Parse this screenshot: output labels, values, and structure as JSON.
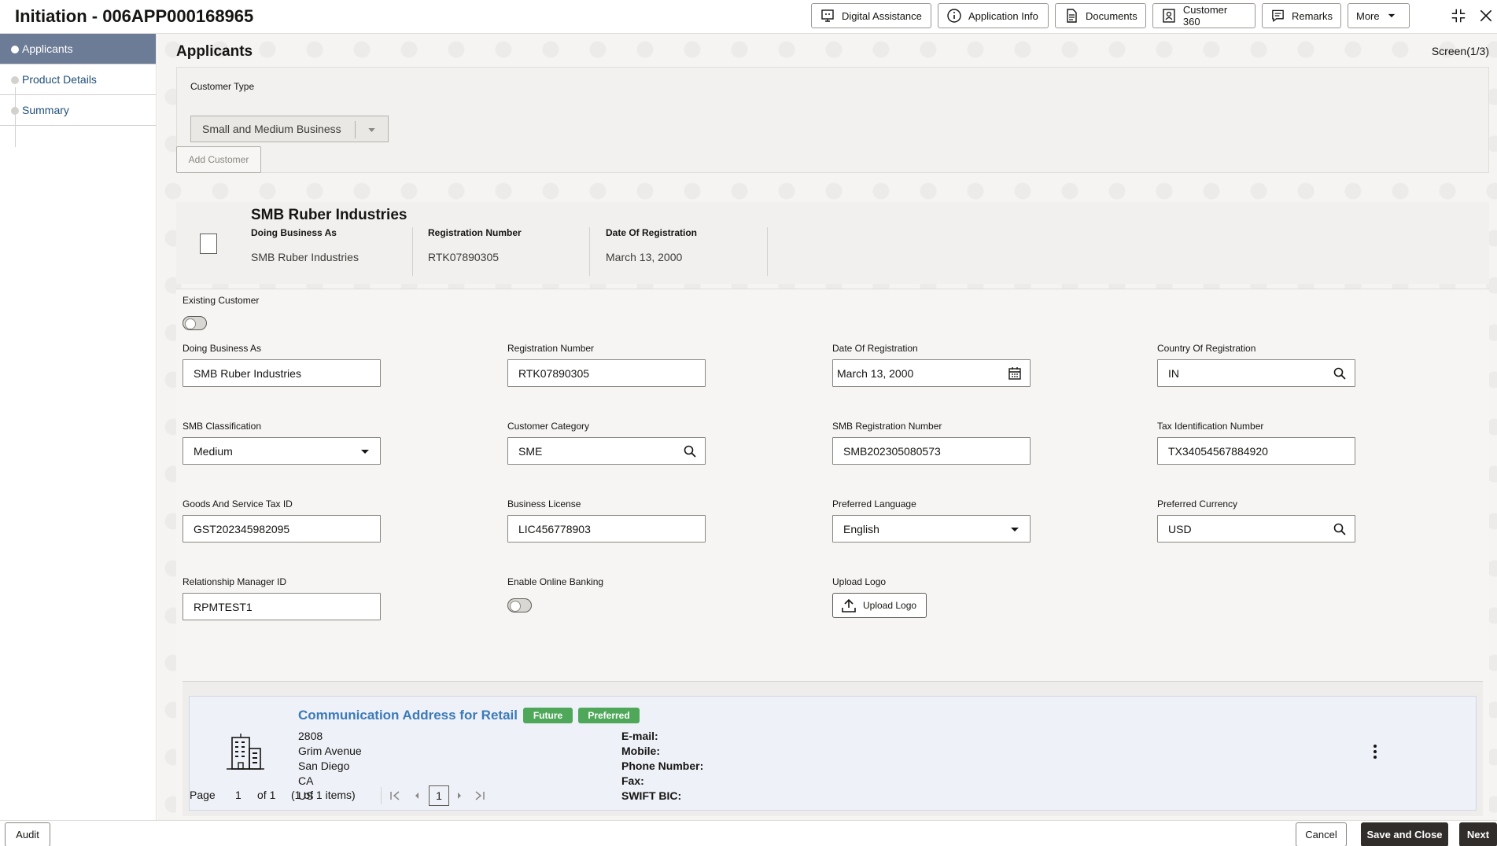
{
  "header": {
    "title": "Initiation - 006APP000168965",
    "buttons": {
      "digital_assistance": "Digital Assistance",
      "application_info": "Application Info",
      "documents": "Documents",
      "customer_360": "Customer 360",
      "remarks": "Remarks",
      "more": "More"
    }
  },
  "sidebar": {
    "items": [
      {
        "label": "Applicants",
        "active": true
      },
      {
        "label": "Product Details",
        "active": false
      },
      {
        "label": "Summary",
        "active": false
      }
    ]
  },
  "main": {
    "title": "Applicants",
    "screen_indicator": "Screen(1/3)",
    "customer_type": {
      "label": "Customer Type",
      "value": "Small and Medium Business"
    },
    "add_customer_label": "Add Customer",
    "customer_card": {
      "name": "SMB Ruber Industries",
      "doing_business_as_label": "Doing Business As",
      "doing_business_as": "SMB Ruber Industries",
      "registration_number_label": "Registration Number",
      "registration_number": "RTK07890305",
      "date_of_registration_label": "Date Of Registration",
      "date_of_registration": "March 13, 2000"
    },
    "form": {
      "existing_customer_label": "Existing Customer",
      "existing_customer": false,
      "doing_business_as": {
        "label": "Doing Business As",
        "value": "SMB Ruber Industries"
      },
      "registration_number": {
        "label": "Registration Number",
        "value": "RTK07890305"
      },
      "date_of_registration": {
        "label": "Date Of Registration",
        "value": "March 13, 2000"
      },
      "country_of_registration": {
        "label": "Country Of Registration",
        "value": "IN"
      },
      "smb_classification": {
        "label": "SMB Classification",
        "value": "Medium"
      },
      "customer_category": {
        "label": "Customer Category",
        "value": "SME"
      },
      "smb_registration_number": {
        "label": "SMB Registration Number",
        "value": "SMB202305080573"
      },
      "tax_identification_number": {
        "label": "Tax Identification Number",
        "value": "TX34054567884920"
      },
      "gst_id": {
        "label": "Goods And Service Tax ID",
        "value": "GST202345982095"
      },
      "business_license": {
        "label": "Business License",
        "value": "LIC456778903"
      },
      "preferred_language": {
        "label": "Preferred Language",
        "value": "English"
      },
      "preferred_currency": {
        "label": "Preferred Currency",
        "value": "USD"
      },
      "relationship_manager_id": {
        "label": "Relationship Manager ID",
        "value": "RPMTEST1"
      },
      "enable_online_banking_label": "Enable Online Banking",
      "enable_online_banking": false,
      "upload_logo_label": "Upload Logo",
      "upload_logo_button": "Upload Logo"
    },
    "address": {
      "title": "Communication Address for Retail",
      "badges": [
        "Future",
        "Preferred"
      ],
      "badge_color": "#4fa85a",
      "lines": [
        "2808",
        "Grim Avenue",
        "San Diego",
        "CA",
        "US"
      ],
      "contact_keys": [
        "E-mail:",
        "Mobile:",
        "Phone Number:",
        "Fax:",
        "SWIFT BIC:"
      ]
    },
    "pager": {
      "page_label": "Page",
      "page": "1",
      "of_label": "of 1",
      "items_label": "(1 of 1 items)",
      "current": "1"
    }
  },
  "footer": {
    "audit": "Audit",
    "cancel": "Cancel",
    "save_and_close": "Save and Close",
    "next": "Next"
  }
}
